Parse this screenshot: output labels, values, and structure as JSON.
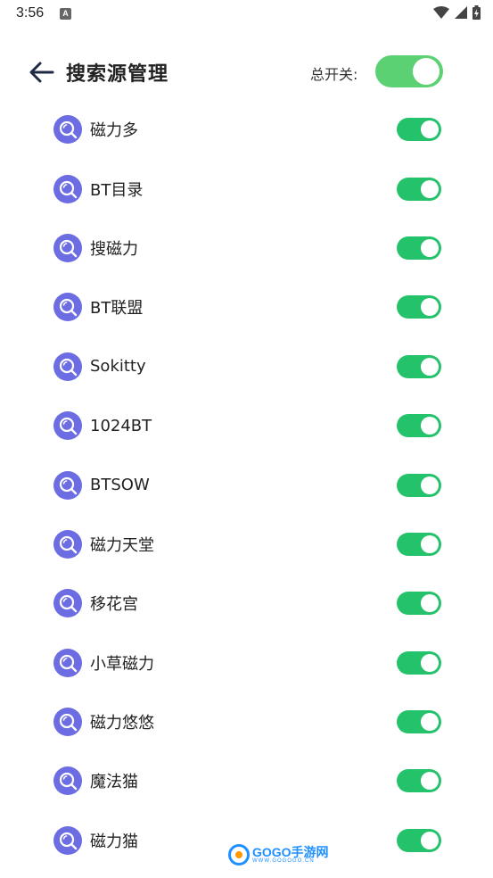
{
  "status_bar": {
    "time": "3:56",
    "notif_letter": "A"
  },
  "header": {
    "title": "搜索源管理",
    "master_label": "总开关:",
    "master_enabled": true
  },
  "sources": [
    {
      "label": "磁力多",
      "enabled": true
    },
    {
      "label": "BT目录",
      "enabled": true
    },
    {
      "label": "搜磁力",
      "enabled": true
    },
    {
      "label": "BT联盟",
      "enabled": true
    },
    {
      "label": "Sokitty",
      "enabled": true
    },
    {
      "label": "1024BT",
      "enabled": true
    },
    {
      "label": "BTSOW",
      "enabled": true
    },
    {
      "label": "磁力天堂",
      "enabled": true
    },
    {
      "label": "移花宫",
      "enabled": true
    },
    {
      "label": "小草磁力",
      "enabled": true
    },
    {
      "label": "磁力悠悠",
      "enabled": true
    },
    {
      "label": "魔法猫",
      "enabled": true
    },
    {
      "label": "磁力猫",
      "enabled": true
    }
  ],
  "watermark": {
    "main": "GOGO手游网",
    "sub": "WWW.GOGOGO.CN"
  },
  "colors": {
    "toggle_on": "#24c26a",
    "master_toggle_on": "#5cd174",
    "icon_bg": "#6c6ce3"
  }
}
